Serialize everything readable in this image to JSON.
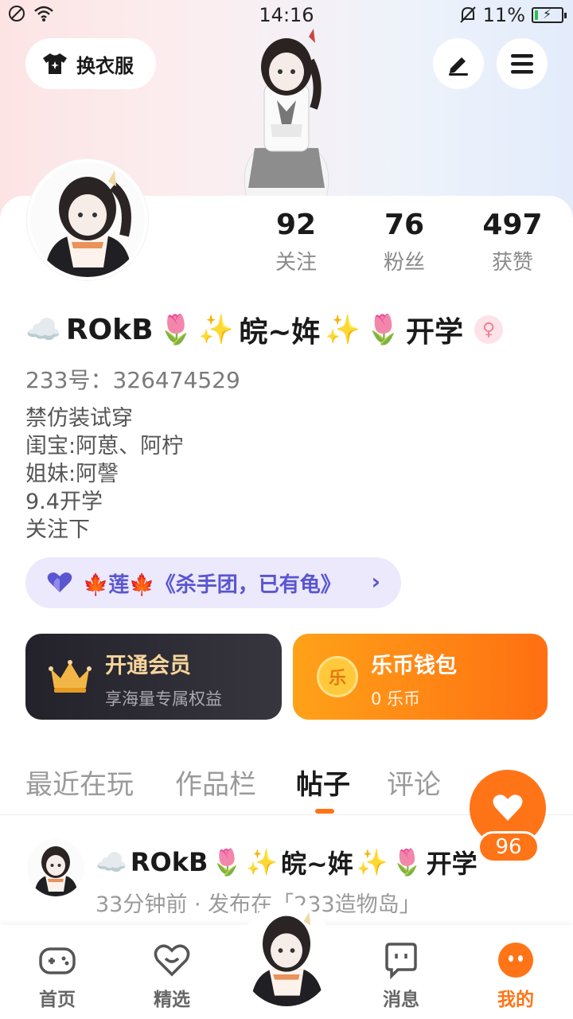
{
  "status_bar": {
    "time": "14:16",
    "battery_text": "11%",
    "battery_level": 0.11,
    "icons": [
      "dnd-icon",
      "wifi-icon",
      "mute-bell-icon",
      "battery-icon"
    ]
  },
  "header": {
    "dress_button_label": "换衣服",
    "dress_icon": "tshirt-icon",
    "edit_icon": "pen-icon",
    "menu_icon": "menu-icon"
  },
  "profile": {
    "stats": [
      {
        "value": "92",
        "label": "关注"
      },
      {
        "value": "76",
        "label": "粉丝"
      },
      {
        "value": "497",
        "label": "获赞"
      }
    ],
    "name_segments": {
      "cloud": "☁️",
      "part1": "ROkB",
      "tulip1": "🌷",
      "sparkle1": "✨",
      "part2": "皖~姩",
      "sparkle2": "✨",
      "tulip2": "🌷",
      "part3": "开学"
    },
    "gender_symbol": "♀",
    "uid": "233号：326474529",
    "bio_lines": [
      "禁仿装试穿",
      "闺宝:阿葸、阿柠",
      "姐妹:阿謦",
      "9.4开学",
      "关注下"
    ]
  },
  "guild": {
    "icon": "heart-icon",
    "leaf_left": "🍁",
    "name": "莲",
    "leaf_right": "🍁",
    "title": "《杀手团，已有龟》",
    "chevron": "›"
  },
  "vip": {
    "title": "开通会员",
    "subtitle": "享海量专属权益",
    "icon": "crown-icon"
  },
  "wallet": {
    "title": "乐币钱包",
    "subtitle": "0 乐币",
    "coin_glyph": "乐"
  },
  "tabs": [
    {
      "label": "最近在玩",
      "active": false
    },
    {
      "label": "作品栏",
      "active": false
    },
    {
      "label": "帖子",
      "active": true
    },
    {
      "label": "评论",
      "active": false
    }
  ],
  "like_fab": {
    "count": "96",
    "icon": "heart-icon"
  },
  "post": {
    "author_segments": {
      "cloud": "☁️",
      "part1": "ROkB",
      "tulip1": "🌷",
      "sparkle1": "✨",
      "part2": "皖~姩",
      "sparkle2": "✨",
      "tulip2": "🌷",
      "part3": "开学"
    },
    "meta": "33分钟前 · 发布在「233造物岛」"
  },
  "bottom_nav": [
    {
      "label": "首页",
      "icon": "gamepad-icon",
      "active": false
    },
    {
      "label": "精选",
      "icon": "heart-box-icon",
      "active": false
    },
    {
      "label": "",
      "icon": "avatar-icon",
      "active": false
    },
    {
      "label": "消息",
      "icon": "chat-icon",
      "active": false
    },
    {
      "label": "我的",
      "icon": "profile-face-icon",
      "active": true
    }
  ],
  "colors": {
    "accent": "#ff7417",
    "guild_bg": "#ebe9fb",
    "guild_text": "#5a55d0",
    "vip_gold": "#f7d59b"
  }
}
